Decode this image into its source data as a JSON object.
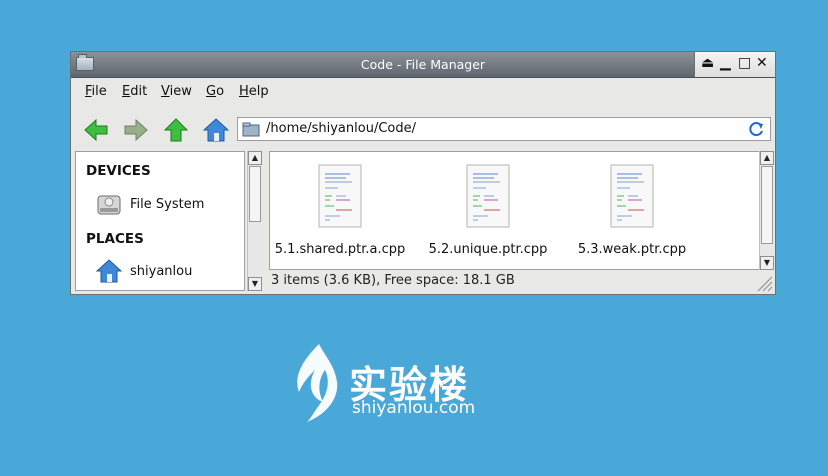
{
  "window": {
    "title": "Code - File Manager",
    "controls": {
      "eject": "⏏",
      "minimize": "▁",
      "maximize": "□",
      "close": "✕"
    }
  },
  "menubar": {
    "items": [
      {
        "accel": "F",
        "rest": "ile"
      },
      {
        "accel": "E",
        "rest": "dit"
      },
      {
        "accel": "V",
        "rest": "iew"
      },
      {
        "accel": "G",
        "rest": "o"
      },
      {
        "accel": "H",
        "rest": "elp"
      }
    ]
  },
  "toolbar": {
    "icons": [
      "back-arrow-icon",
      "forward-arrow-icon",
      "up-arrow-icon",
      "home-icon"
    ],
    "path": "/home/shiyanlou/Code/",
    "refresh_icon": "refresh-icon"
  },
  "sidebar": {
    "devices_header": "DEVICES",
    "devices": [
      {
        "label": "File System",
        "icon": "hard-disk-icon"
      }
    ],
    "places_header": "PLACES",
    "places": [
      {
        "label": "shiyanlou",
        "icon": "home-icon"
      }
    ]
  },
  "files": [
    {
      "name": "5.1.shared.ptr.a.cpp",
      "icon": "text-file-icon"
    },
    {
      "name": "5.2.unique.ptr.cpp",
      "icon": "text-file-icon"
    },
    {
      "name": "5.3.weak.ptr.cpp",
      "icon": "text-file-icon"
    }
  ],
  "status": {
    "text": "3 items (3.6 KB), Free space: 18.1 GB"
  },
  "brand": {
    "cn": "实验楼",
    "en": "shiyanlou.com"
  },
  "colors": {
    "background": "#4aa8d8",
    "titlebar": "#6f7780",
    "arrow_green": "#3fbf3f",
    "home_blue": "#3f88d8"
  }
}
